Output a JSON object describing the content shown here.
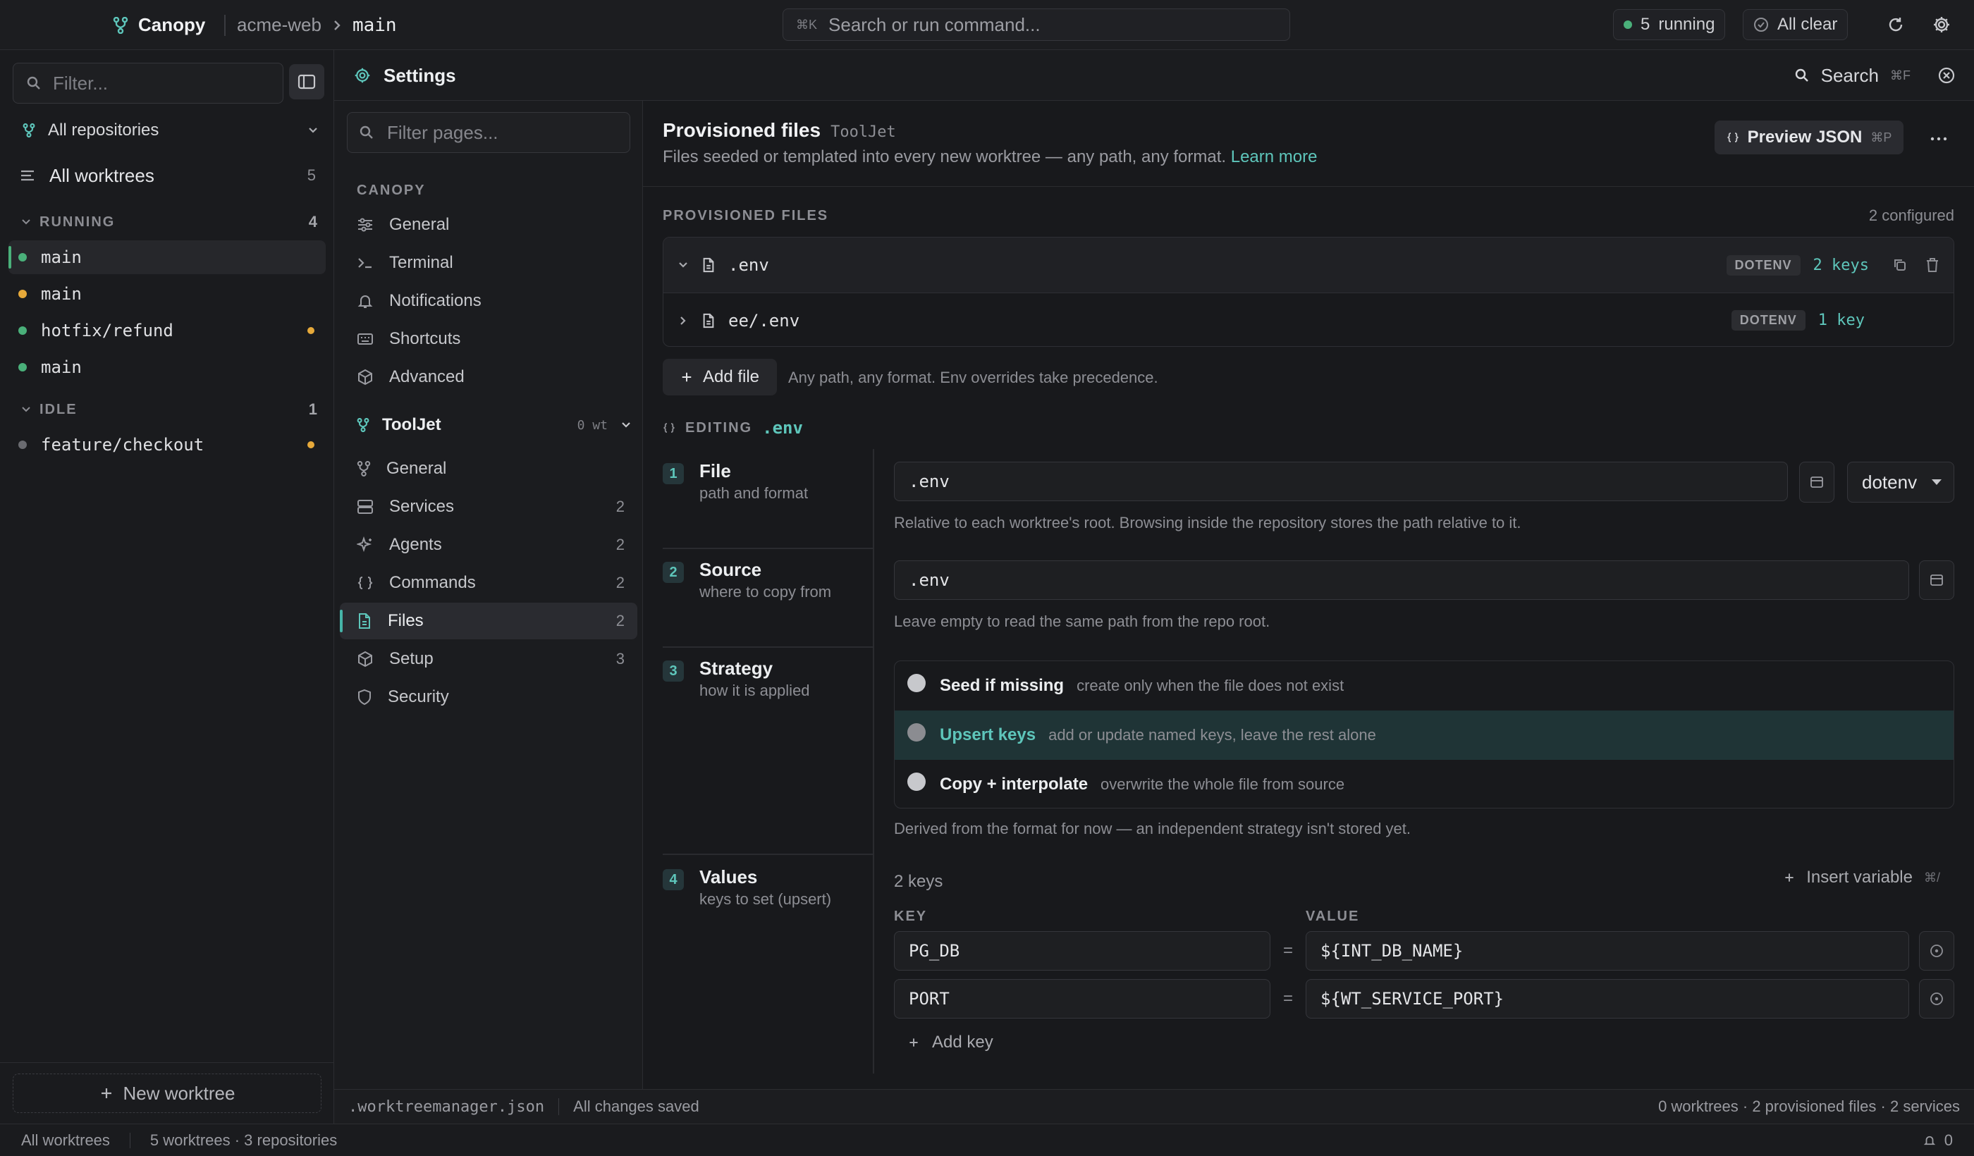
{
  "topbar": {
    "app_name": "Canopy",
    "repo": "acme-web",
    "branch": "main",
    "command_kbd": "⌘K",
    "command_placeholder": "Search or run command...",
    "running_count": "5",
    "running_label": "running",
    "status_label": "All clear"
  },
  "sidebar": {
    "filter_placeholder": "Filter...",
    "repo_selector": "All repositories",
    "all_worktrees": {
      "label": "All worktrees",
      "count": "5"
    },
    "groups": [
      {
        "label": "RUNNING",
        "count": "4",
        "items": [
          {
            "name": "main",
            "status_color": "#4ab07a"
          },
          {
            "name": "main",
            "status_color": "#e6a93a"
          },
          {
            "name": "hotfix/refund",
            "status_color": "#4ab07a",
            "modified": true
          },
          {
            "name": "main",
            "status_color": "#4ab07a"
          }
        ]
      },
      {
        "label": "IDLE",
        "count": "1",
        "items": [
          {
            "name": "feature/checkout",
            "status_color": "#6a6b70",
            "modified": true
          }
        ]
      }
    ],
    "new_worktree": "New worktree"
  },
  "settings": {
    "title": "Settings",
    "search_label": "Search",
    "search_kbd": "⌘F",
    "filter_placeholder": "Filter pages...",
    "canopy_header": "CANOPY",
    "canopy_items": [
      {
        "label": "General",
        "icon": "sliders-icon"
      },
      {
        "label": "Terminal",
        "icon": "terminal-icon"
      },
      {
        "label": "Notifications",
        "icon": "bell-icon"
      },
      {
        "label": "Shortcuts",
        "icon": "keyboard-icon"
      },
      {
        "label": "Advanced",
        "icon": "cube-icon"
      }
    ],
    "project": {
      "name": "ToolJet",
      "wt_count": "0 wt"
    },
    "project_items": [
      {
        "label": "General",
        "icon": "branch-icon",
        "count": ""
      },
      {
        "label": "Services",
        "icon": "server-icon",
        "count": "2"
      },
      {
        "label": "Agents",
        "icon": "sparkle-icon",
        "count": "2"
      },
      {
        "label": "Commands",
        "icon": "braces-icon",
        "count": "2"
      },
      {
        "label": "Files",
        "icon": "file-icon",
        "count": "2",
        "selected": true
      },
      {
        "label": "Setup",
        "icon": "cube-icon",
        "count": "3"
      },
      {
        "label": "Security",
        "icon": "shield-icon",
        "count": ""
      }
    ]
  },
  "provisioned": {
    "title": "Provisioned files",
    "project_tag": "ToolJet",
    "description": "Files seeded or templated into every new worktree — any path, any format.",
    "learn_more": "Learn more",
    "preview_label": "Preview JSON",
    "preview_kbd": "⌘P",
    "section_label": "PROVISIONED FILES",
    "configured": "2 configured",
    "files": [
      {
        "path": ".env",
        "format": "DOTENV",
        "keys": "2 keys",
        "expanded": true
      },
      {
        "path": "ee/.env",
        "format": "DOTENV",
        "keys": "1 key",
        "expanded": false
      }
    ],
    "add_file": "Add file",
    "add_hint": "Any path, any format. Env overrides take precedence."
  },
  "editor": {
    "editing_label": "EDITING",
    "editing_file": ".env",
    "steps": [
      {
        "num": "1",
        "title": "File",
        "subtitle": "path and format"
      },
      {
        "num": "2",
        "title": "Source",
        "subtitle": "where to copy from"
      },
      {
        "num": "3",
        "title": "Strategy",
        "subtitle": "how it is applied"
      },
      {
        "num": "4",
        "title": "Values",
        "subtitle": "keys to set (upsert)"
      }
    ],
    "file_path": ".env",
    "format": "dotenv",
    "file_hint": "Relative to each worktree's root. Browsing inside the repository stores the path relative to it.",
    "source_path": ".env",
    "source_hint": "Leave empty to read the same path from the repo root.",
    "strategies": [
      {
        "label": "Seed if missing",
        "desc": "create only when the file does not exist",
        "selected": false
      },
      {
        "label": "Upsert keys",
        "desc": "add or update named keys, leave the rest alone",
        "selected": true
      },
      {
        "label": "Copy + interpolate",
        "desc": "overwrite the whole file from source",
        "selected": false
      }
    ],
    "strategy_hint": "Derived from the format for now — an independent strategy isn't stored yet.",
    "keys_count": "2 keys",
    "insert_variable": "Insert variable",
    "insert_kbd": "⌘/",
    "key_header": "KEY",
    "value_header": "VALUE",
    "equals": "=",
    "values": [
      {
        "key": "PG_DB",
        "value": "${INT_DB_NAME}"
      },
      {
        "key": "PORT",
        "value": "${WT_SERVICE_PORT}"
      }
    ],
    "add_key": "Add key"
  },
  "mainfooter": {
    "config_file": ".worktreemanager.json",
    "save_state": "All changes saved",
    "summary": "0 worktrees · 2 provisioned files · 2 services"
  },
  "statusbar": {
    "scope": "All worktrees",
    "summary": "5 worktrees · 3 repositories",
    "notifications": "0"
  },
  "colors": {
    "accent": "#5ec6bb",
    "running": "#4ab07a",
    "warning": "#e6a93a"
  }
}
